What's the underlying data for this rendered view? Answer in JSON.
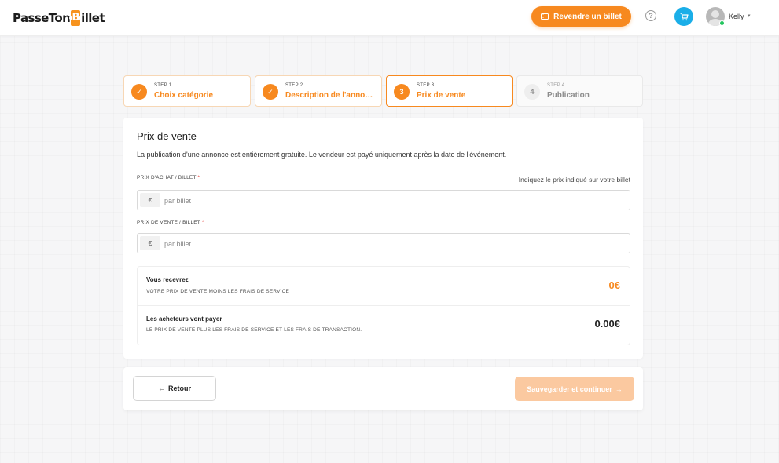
{
  "header": {
    "logo_part1": "PasseTon",
    "logo_ticket_letter": "B",
    "logo_part2": "illet",
    "resell_label": "Revendre un billet",
    "help_glyph": "?",
    "user_name": "Kelly",
    "user_caret": "▾"
  },
  "steps": [
    {
      "num": "STEP 1",
      "title": "Choix catégorie",
      "state": "done",
      "marker": "✓"
    },
    {
      "num": "STEP 2",
      "title": "Description de l'annon...",
      "state": "done",
      "marker": "✓"
    },
    {
      "num": "STEP 3",
      "title": "Prix de vente",
      "state": "active",
      "marker": "3"
    },
    {
      "num": "STEP 4",
      "title": "Publication",
      "state": "pending",
      "marker": "4"
    }
  ],
  "card": {
    "title": "Prix de vente",
    "description": "La publication d'une annonce est entièrement gratuite. Le vendeur est payé uniquement après la date de l'événement.",
    "purchase": {
      "label": "PRIX D'ACHAT / BILLET",
      "required_mark": "*",
      "hint": "Indiquez le prix indiqué sur votre billet",
      "prefix": "€",
      "placeholder": "par billet",
      "value": ""
    },
    "sale": {
      "label": "PRIX DE VENTE / BILLET",
      "required_mark": "*",
      "prefix": "€",
      "placeholder": "par billet",
      "value": ""
    },
    "summary": {
      "receive_title": "Vous recevrez",
      "receive_sub": "VOTRE PRIX DE VENTE MOINS LES FRAIS DE SERVICE",
      "receive_value": "0€",
      "buyers_title": "Les acheteurs vont payer",
      "buyers_sub": "LE PRIX DE VENTE PLUS LES FRAIS DE SERVICE ET LES FRAIS DE TRANSACTION.",
      "buyers_value": "0.00€"
    }
  },
  "footer": {
    "back_label": "Retour",
    "back_arrow": "←",
    "save_label": "Sauvegarder et continuer",
    "save_arrow": "→"
  },
  "colors": {
    "accent": "#f7891f",
    "cart": "#1aaee8",
    "save_disabled": "#fbc9a0",
    "required": "#e53935"
  }
}
